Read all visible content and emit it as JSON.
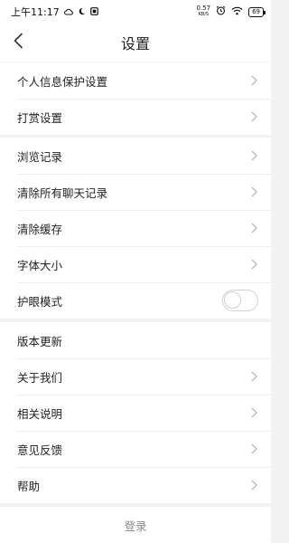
{
  "status_bar": {
    "time": "上午11:17",
    "net_speed_value": "0.57",
    "net_speed_unit": "KB/S",
    "battery": "69"
  },
  "nav": {
    "title": "设置"
  },
  "groups": [
    {
      "items": [
        {
          "label": "个人信息保护设置"
        },
        {
          "label": "打赏设置"
        }
      ]
    },
    {
      "items": [
        {
          "label": "浏览记录"
        },
        {
          "label": "清除所有聊天记录"
        },
        {
          "label": "清除缓存"
        },
        {
          "label": "字体大小"
        },
        {
          "label": "护眼模式",
          "toggle_on": false
        }
      ]
    },
    {
      "items": [
        {
          "label": "版本更新"
        },
        {
          "label": "关于我们"
        },
        {
          "label": "相关说明"
        },
        {
          "label": "意见反馈"
        },
        {
          "label": "帮助"
        }
      ]
    }
  ],
  "login": {
    "label": "登录"
  },
  "colors": {
    "page_bg": "#f2f2f2",
    "card_bg": "#ffffff",
    "chevron": "#b8b8b8",
    "login_text": "#8a8a8a"
  },
  "icons": [
    "back-arrow-icon",
    "chevron-right-icon",
    "alarm-icon",
    "wifi-icon",
    "battery-icon"
  ]
}
